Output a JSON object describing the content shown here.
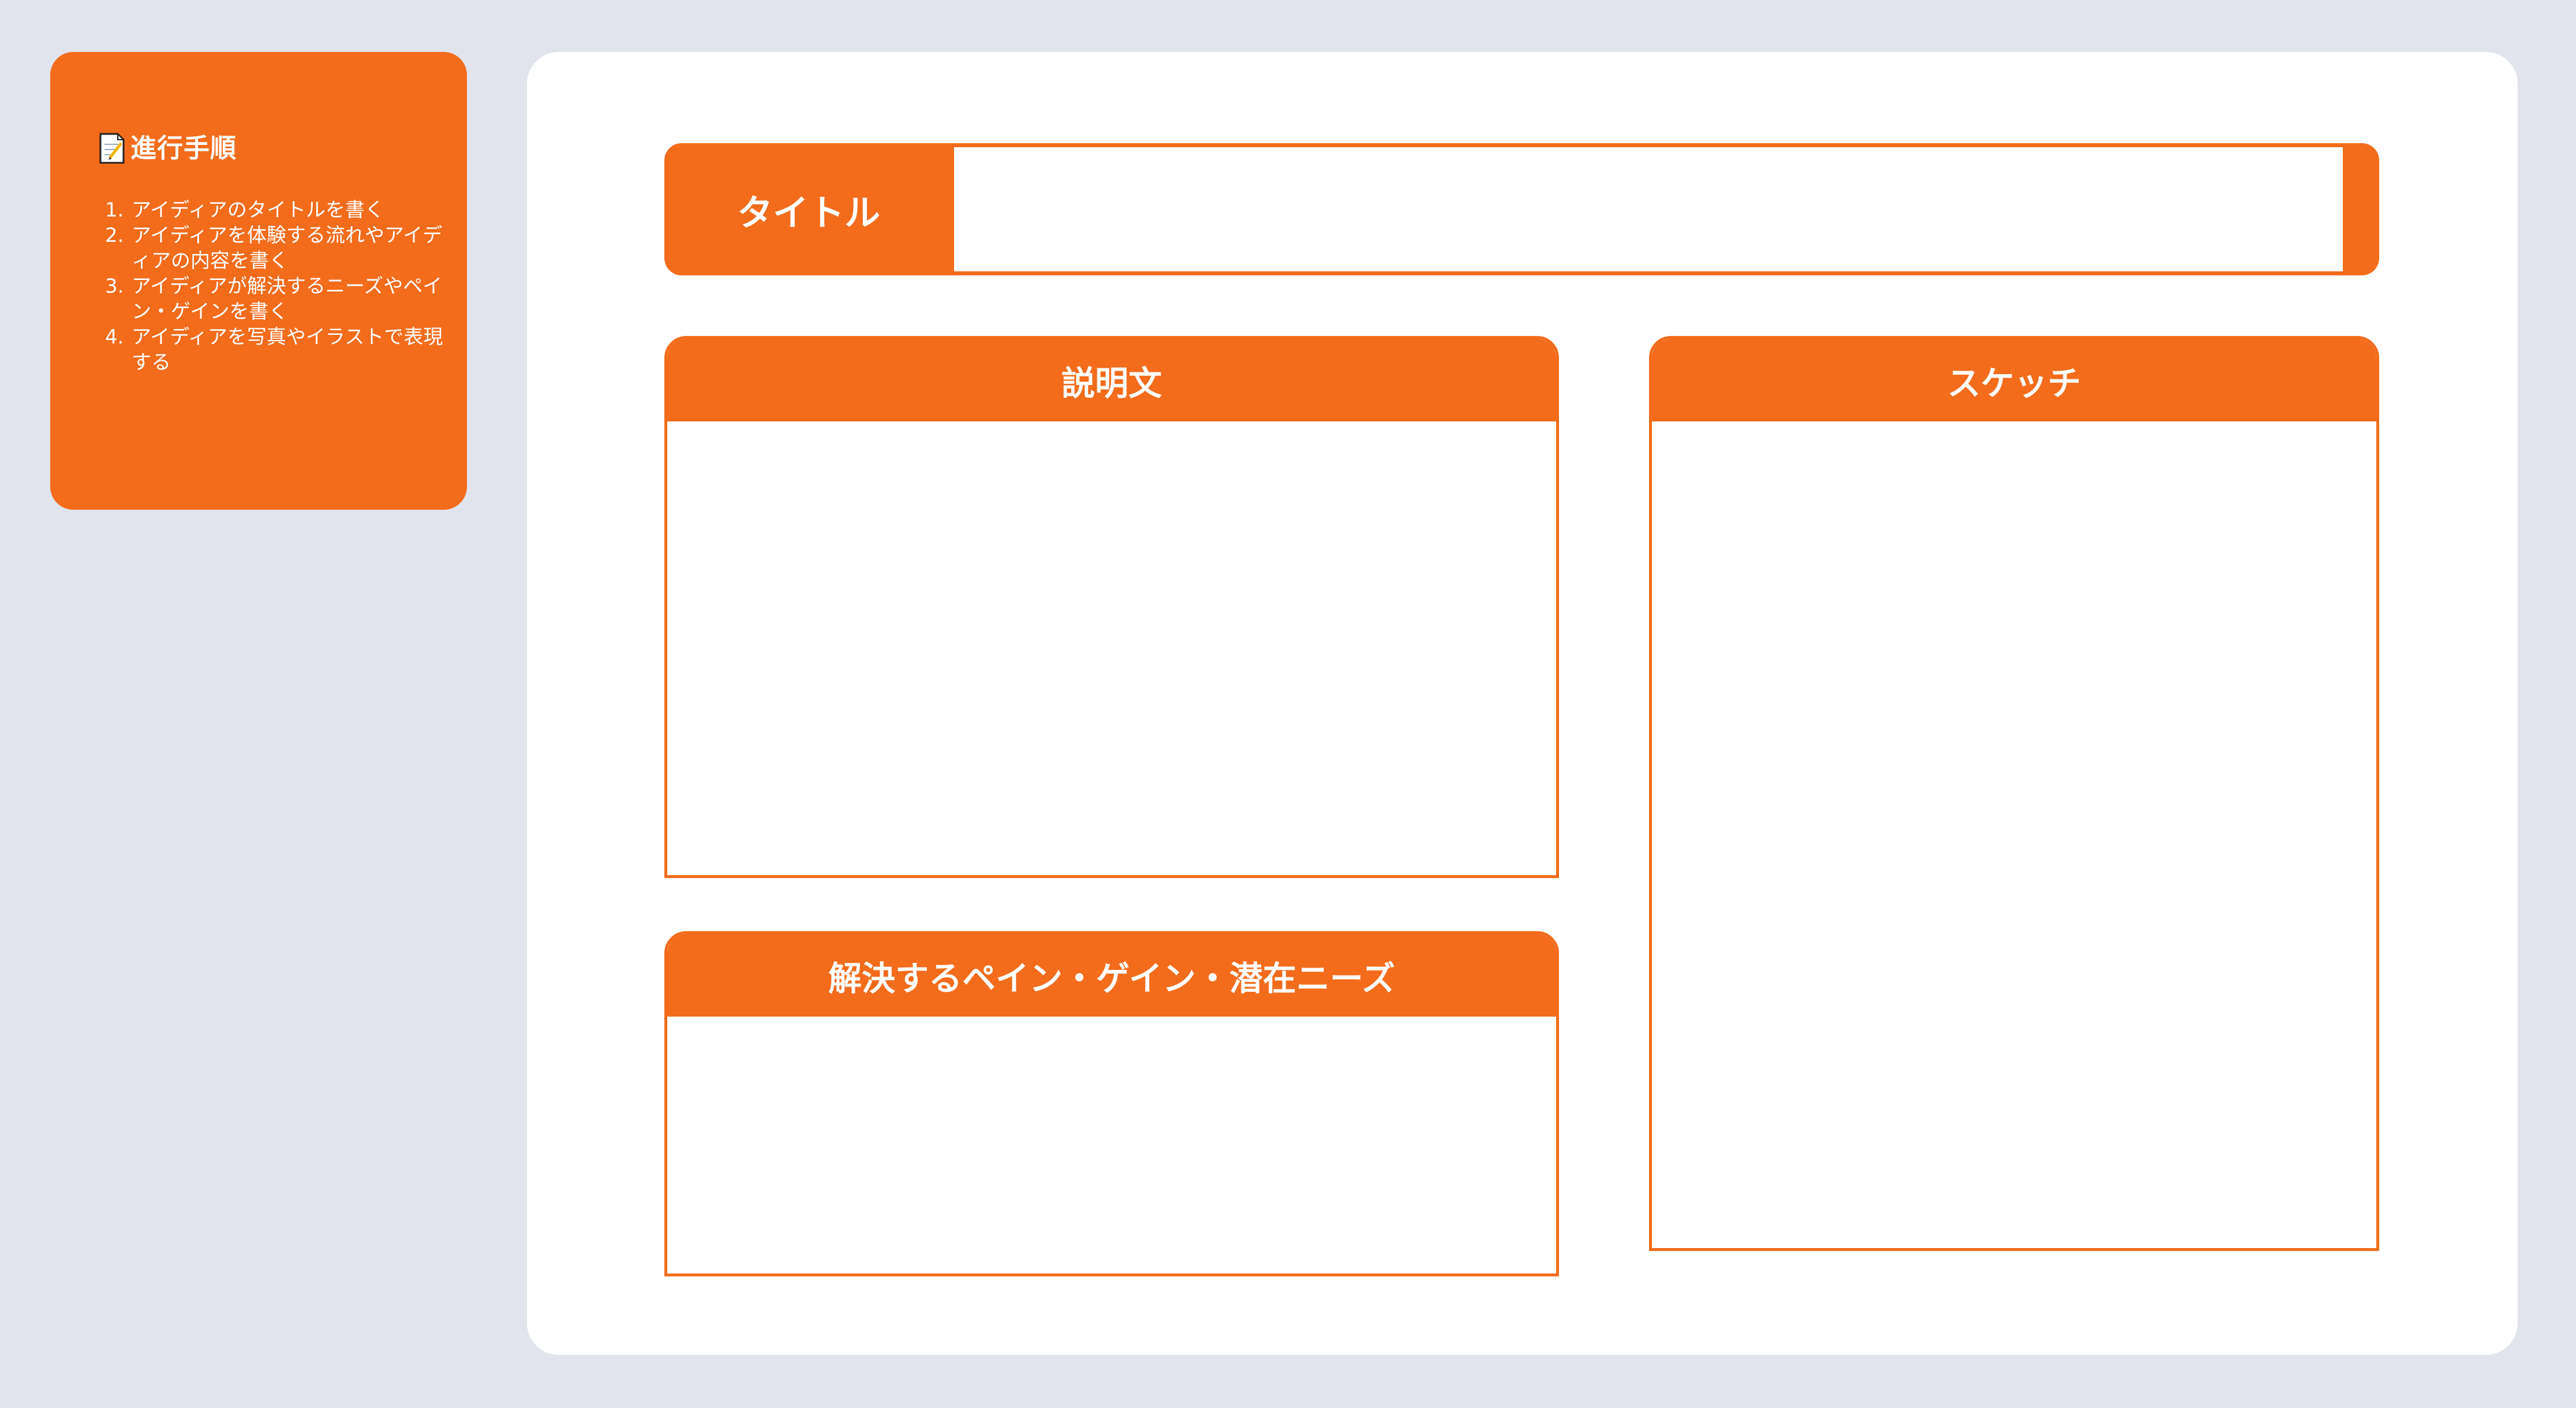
{
  "instructions": {
    "icon": "memo-icon",
    "title": "進行手順",
    "steps": [
      {
        "num": "1.",
        "text": "アイディアのタイトルを書く"
      },
      {
        "num": "2.",
        "text": "アイディアを体験する流れやアイディアの内容を書く"
      },
      {
        "num": "3.",
        "text": "アイディアが解決するニーズやペイン・ゲインを書く"
      },
      {
        "num": "4.",
        "text": "アイディアを写真やイラストで表現する"
      }
    ]
  },
  "title_field": {
    "label": "タイトル",
    "value": ""
  },
  "panels": {
    "description": {
      "header": "説明文",
      "value": ""
    },
    "pain_gain": {
      "header": "解決するペイン・ゲイン・潜在ニーズ",
      "value": ""
    },
    "sketch": {
      "header": "スケッチ",
      "value": ""
    }
  },
  "colors": {
    "accent": "#f26c1c",
    "background": "#e1e4ec",
    "board": "#ffffff"
  }
}
